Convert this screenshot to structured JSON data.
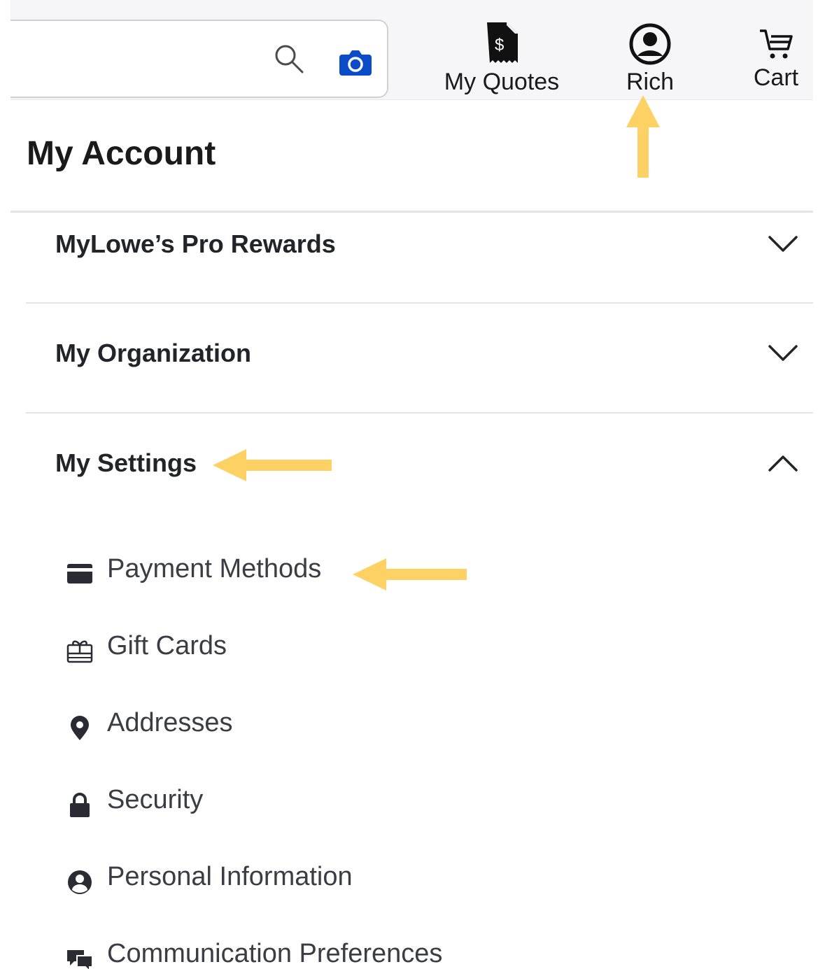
{
  "header": {
    "search": {
      "placeholder": "",
      "search_icon": "search-icon",
      "camera_icon": "camera-icon"
    },
    "nav": {
      "quotes_label": "My Quotes",
      "account_label": "Rich",
      "cart_label": "Cart"
    }
  },
  "page": {
    "title": "My Account"
  },
  "accordion": {
    "rewards": {
      "label": "MyLowe’s Pro Rewards",
      "expanded": false
    },
    "organization": {
      "label": "My Organization",
      "expanded": false
    },
    "settings": {
      "label": "My Settings",
      "expanded": true
    }
  },
  "settings_items": [
    {
      "label": "Payment Methods",
      "icon": "credit-card-icon"
    },
    {
      "label": "Gift Cards",
      "icon": "gift-card-icon"
    },
    {
      "label": "Addresses",
      "icon": "map-pin-icon"
    },
    {
      "label": "Security",
      "icon": "lock-icon"
    },
    {
      "label": "Personal Information",
      "icon": "user-circle-icon"
    },
    {
      "label": "Communication Preferences",
      "icon": "chat-bubbles-icon"
    }
  ],
  "colors": {
    "annotation_arrow": "#fdd164",
    "camera_blue": "#0a4bc7",
    "header_bg": "#f6f6f9",
    "divider": "#e3e4ea"
  }
}
